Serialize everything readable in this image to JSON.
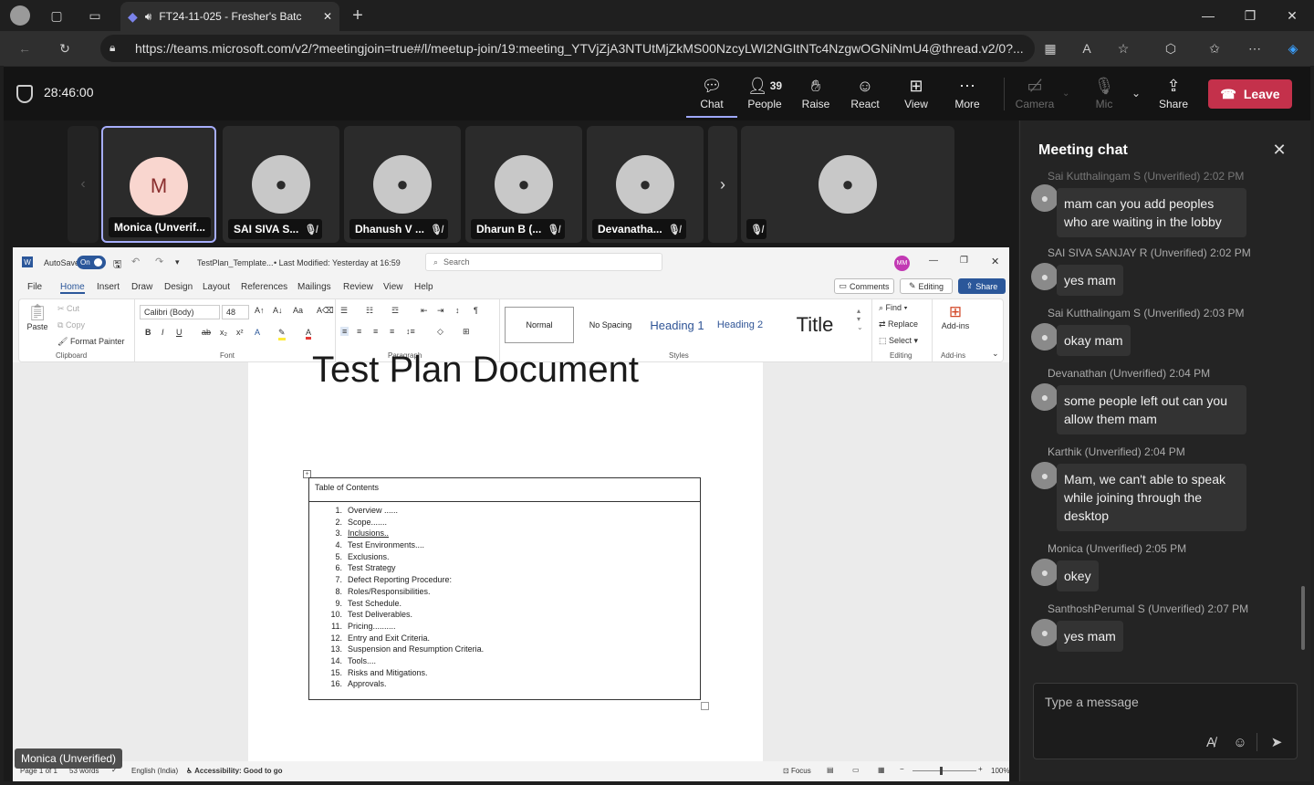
{
  "browser": {
    "tab_title": "FT24-11-025 - Fresher's Batc",
    "url": "https://teams.microsoft.com/v2/?meetingjoin=true#/l/meetup-join/19:meeting_YTVjZjA3NTUtMjZkMS00NzcyLWI2NGItNTc4NzgwOGNiNmU4@thread.v2/0?..."
  },
  "meeting": {
    "timer": "28:46:00",
    "buttons": {
      "chat": "Chat",
      "people": "People",
      "people_count": "39",
      "raise": "Raise",
      "react": "React",
      "view": "View",
      "more": "More",
      "camera": "Camera",
      "mic": "Mic",
      "share": "Share"
    },
    "leave_label": "Leave"
  },
  "participants": [
    {
      "name": "Monica (Unverif...",
      "initial": "M"
    },
    {
      "name": "SAI SIVA S..."
    },
    {
      "name": "Dhanush V ..."
    },
    {
      "name": "Dharun B (..."
    },
    {
      "name": "Devanatha..."
    }
  ],
  "presenter_label": "Monica (Unverified)",
  "word": {
    "autosave": "AutoSave",
    "autosave_state": "On",
    "doc_name": "TestPlan_Template...",
    "modified": "• Last Modified: Yesterday at 16:59",
    "search_placeholder": "Search",
    "user_initials": "MM",
    "comments": "Comments",
    "editing": "Editing",
    "share": "Share",
    "tabs": [
      "File",
      "Home",
      "Insert",
      "Draw",
      "Design",
      "Layout",
      "References",
      "Mailings",
      "Review",
      "View",
      "Help"
    ],
    "clipboard": {
      "paste": "Paste",
      "cut": "Cut",
      "copy": "Copy",
      "format_painter": "Format Painter",
      "group": "Clipboard"
    },
    "font": {
      "name": "Calibri (Body)",
      "size": "48",
      "group": "Font"
    },
    "paragraph_group": "Paragraph",
    "styles": {
      "normal": "Normal",
      "no_spacing": "No Spacing",
      "heading1": "Heading 1",
      "heading2": "Heading 2",
      "title": "Title",
      "group": "Styles"
    },
    "editing_group": {
      "find": "Find",
      "replace": "Replace",
      "select": "Select",
      "group": "Editing"
    },
    "addins": {
      "label": "Add-ins",
      "group": "Add-ins"
    },
    "doc_title": "Test Plan Document",
    "toc_heading": "Table of Contents",
    "toc": [
      "Overview ......",
      "Scope.......",
      "Inclusions..",
      "Test Environments....",
      "Exclusions.",
      "Test Strategy",
      "Defect Reporting Procedure:",
      "Roles/Responsibilities.",
      "Test Schedule.",
      "Test Deliverables.",
      "Pricing..........",
      "Entry and Exit Criteria.",
      "Suspension and Resumption Criteria.",
      "Tools....",
      "Risks and Mitigations.",
      "Approvals."
    ],
    "status": {
      "page": "Page 1 of 1",
      "words": "53 words",
      "language": "English (India)",
      "accessibility": "Accessibility: Good to go",
      "focus": "Focus",
      "zoom": "100%"
    }
  },
  "chat": {
    "title": "Meeting chat",
    "truncated_head": "Sai Kutthalingam S (Unverified) 2:02 PM",
    "messages": [
      {
        "sender": "",
        "time": "",
        "text": "mam can you add peoples who are waiting in the lobby"
      },
      {
        "sender": "SAI SIVA SANJAY R (Unverified)",
        "time": "2:02 PM",
        "text": "yes mam"
      },
      {
        "sender": "Sai Kutthalingam S (Unverified)",
        "time": "2:03 PM",
        "text": "okay mam"
      },
      {
        "sender": "Devanathan (Unverified)",
        "time": "2:04 PM",
        "text": "some people left out can you allow them mam"
      },
      {
        "sender": "Karthik (Unverified)",
        "time": "2:04 PM",
        "text": "Mam, we can't able to speak while joining through the desktop"
      },
      {
        "sender": "Monica (Unverified)",
        "time": "2:05 PM",
        "text": "okey"
      },
      {
        "sender": "SanthoshPerumal S (Unverified)",
        "time": "2:07 PM",
        "text": "yes mam"
      }
    ],
    "compose_placeholder": "Type a message"
  }
}
